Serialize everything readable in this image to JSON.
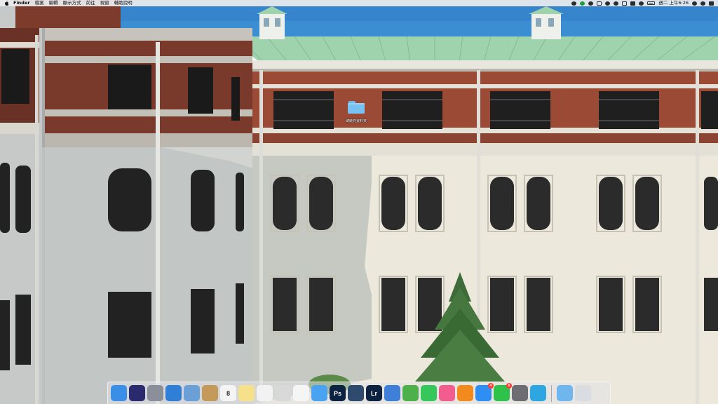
{
  "menubar": {
    "apple_icon": "apple-logo-icon",
    "items": [
      {
        "label": "Finder",
        "bold": true
      },
      {
        "label": "檔案"
      },
      {
        "label": "編輯"
      },
      {
        "label": "顯示方式"
      },
      {
        "label": "前往"
      },
      {
        "label": "視窗"
      },
      {
        "label": "輔助說明"
      }
    ],
    "status_icons": [
      "dropbox-icon",
      "wechat-icon",
      "time-machine-icon",
      "screen-mirroring-icon",
      "bluetooth-icon",
      "wifi-icon",
      "display-icon",
      "input-source-icon",
      "volume-icon",
      "battery-icon"
    ],
    "clock": "週二 上午6:26",
    "trailing_icons": [
      "spotlight-icon",
      "siri-icon",
      "notification-center-icon"
    ]
  },
  "desktop": {
    "folder": {
      "label": "總統府資料夾",
      "icon": "folder-icon"
    }
  },
  "dock": {
    "apps": [
      {
        "name": "finder",
        "color": "#3a8ee6"
      },
      {
        "name": "siri",
        "color": "#2a2a6e"
      },
      {
        "name": "launchpad",
        "color": "#8a8f9a"
      },
      {
        "name": "safari",
        "color": "#2f7fd6"
      },
      {
        "name": "preview",
        "color": "#6a9fd8"
      },
      {
        "name": "contacts",
        "color": "#c49a5a"
      },
      {
        "name": "calendar",
        "color": "#f4f4f4",
        "text": "8"
      },
      {
        "name": "notes",
        "color": "#f6e08a"
      },
      {
        "name": "reminders",
        "color": "#f2f2f2"
      },
      {
        "name": "photo-booth",
        "color": "#d8d8d8"
      },
      {
        "name": "photos",
        "color": "#f5f5f5"
      },
      {
        "name": "messages",
        "color": "#4aa3f0"
      },
      {
        "name": "photoshop",
        "color": "#0b2240",
        "text": "Ps"
      },
      {
        "name": "camera-app",
        "color": "#2e4b6e"
      },
      {
        "name": "lightroom",
        "color": "#0b2240",
        "text": "Lr"
      },
      {
        "name": "keynote",
        "color": "#3f7fd8"
      },
      {
        "name": "numbers",
        "color": "#4eb04a"
      },
      {
        "name": "facetime",
        "color": "#35c759"
      },
      {
        "name": "itunes",
        "color": "#f25c8f"
      },
      {
        "name": "ibooks",
        "color": "#f28a1e"
      },
      {
        "name": "app-store",
        "color": "#2f8ef4",
        "badge": "4"
      },
      {
        "name": "line",
        "color": "#2fc24a",
        "badge": "6"
      },
      {
        "name": "system-preferences",
        "color": "#6e6e72"
      },
      {
        "name": "telegram",
        "color": "#2ea6e0"
      }
    ],
    "trailing": [
      {
        "name": "downloads-folder",
        "color": "#6fb6ee"
      },
      {
        "name": "trash",
        "color": "#d9dde2"
      }
    ]
  }
}
